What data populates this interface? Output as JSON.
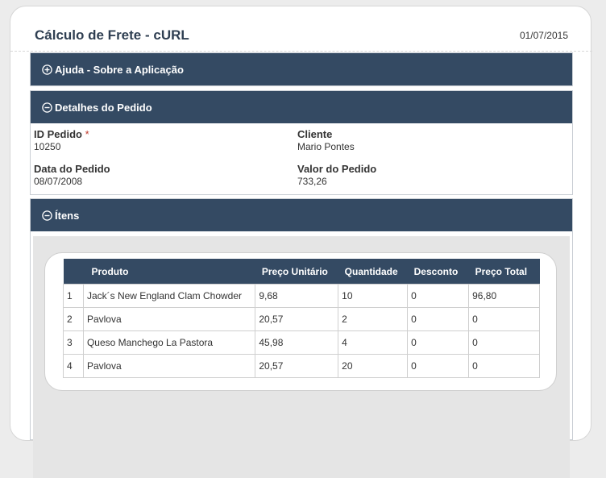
{
  "header": {
    "title": "Cálculo de Frete - cURL",
    "date": "01/07/2015"
  },
  "sections": {
    "help": {
      "label": "Ajuda - Sobre a Aplicação"
    },
    "order": {
      "label": "Detalhes do Pedido",
      "fields": {
        "id": {
          "label": "ID Pedido",
          "required_mark": "*",
          "value": "10250"
        },
        "client": {
          "label": "Cliente",
          "value": "Mario Pontes"
        },
        "date": {
          "label": "Data do Pedido",
          "value": "08/07/2008"
        },
        "total": {
          "label": "Valor do Pedido",
          "value": "733,26"
        }
      }
    },
    "items": {
      "label": "Ítens",
      "columns": [
        "",
        "Produto",
        "Preço Unitário",
        "Quantidade",
        "Desconto",
        "Preço Total"
      ],
      "rows": [
        [
          "1",
          "Jack´s New England Clam Chowder",
          "9,68",
          "10",
          "0",
          "96,80"
        ],
        [
          "2",
          "Pavlova",
          "20,57",
          "2",
          "0",
          "0"
        ],
        [
          "3",
          "Queso Manchego La Pastora",
          "45,98",
          "4",
          "0",
          "0"
        ],
        [
          "4",
          "Pavlova",
          "20,57",
          "20",
          "0",
          "0"
        ]
      ]
    }
  },
  "icons": {
    "expand": "plus-circle-icon",
    "collapse": "minus-circle-icon"
  },
  "colors": {
    "panel_header": "#344a63",
    "required": "#c0392b"
  }
}
